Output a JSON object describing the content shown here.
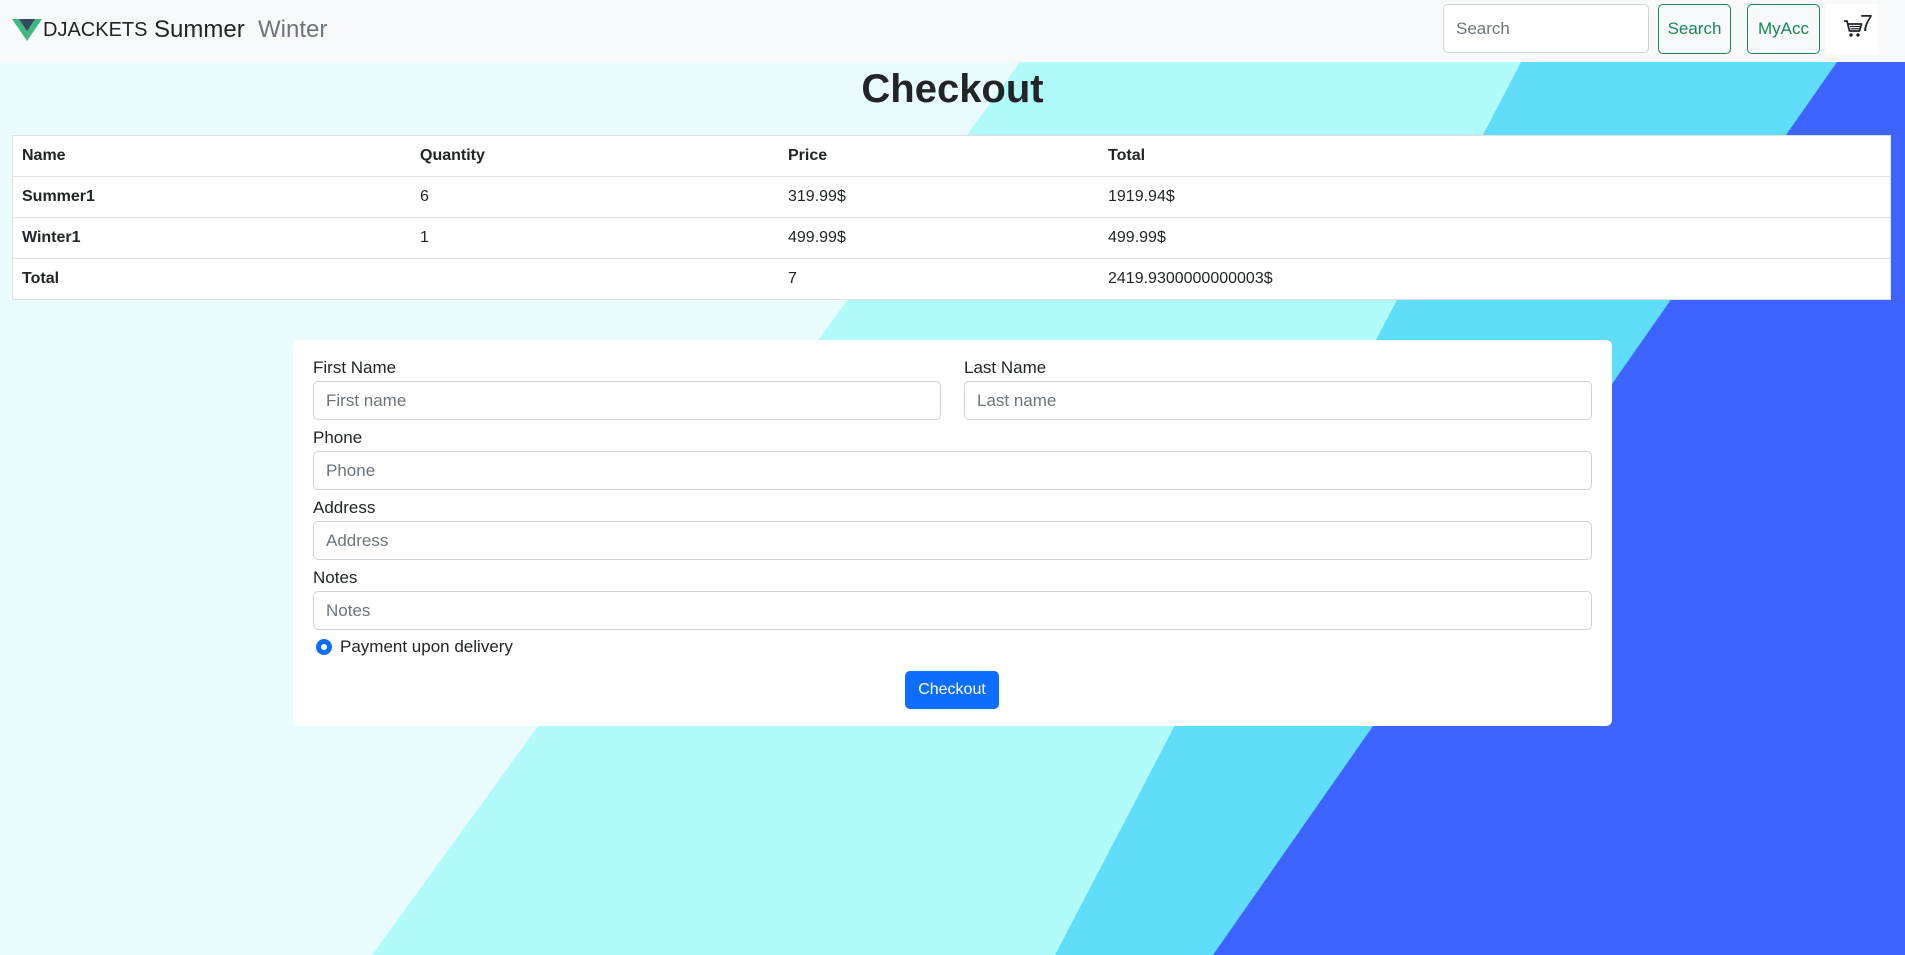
{
  "brand": {
    "name": "DJACKETS",
    "logo_icon": "v-logo-icon"
  },
  "nav": {
    "links": [
      {
        "label": "Summer"
      },
      {
        "label": "Winter"
      }
    ]
  },
  "search": {
    "placeholder": "Search",
    "button_label": "Search"
  },
  "account": {
    "label": "MyAcc"
  },
  "cart": {
    "icon": "cart-icon",
    "count": "7"
  },
  "page": {
    "title": "Checkout"
  },
  "table": {
    "headers": [
      "Name",
      "Quantity",
      "Price",
      "Total"
    ],
    "rows": [
      {
        "name": "Summer1",
        "quantity": "6",
        "price": "319.99$",
        "total": "1919.94$"
      },
      {
        "name": "Winter1",
        "quantity": "1",
        "price": "499.99$",
        "total": "499.99$"
      }
    ],
    "footer": {
      "label": "Total",
      "quantity": "7",
      "total": "2419.9300000000003$"
    }
  },
  "form": {
    "first_name": {
      "label": "First Name",
      "placeholder": "First name"
    },
    "last_name": {
      "label": "Last Name",
      "placeholder": "Last name"
    },
    "phone": {
      "label": "Phone",
      "placeholder": "Phone"
    },
    "address": {
      "label": "Address",
      "placeholder": "Address"
    },
    "notes": {
      "label": "Notes",
      "placeholder": "Notes"
    },
    "payment_option": {
      "label": "Payment upon delivery",
      "selected": true
    },
    "submit_label": "Checkout"
  },
  "colors": {
    "background_light": "#eafcfd",
    "stripe_cyan_light": "#b2fbfb",
    "stripe_cyan": "#60def9",
    "stripe_blue": "#3f63fe",
    "primary": "#0d6efd",
    "success": "#198754"
  }
}
